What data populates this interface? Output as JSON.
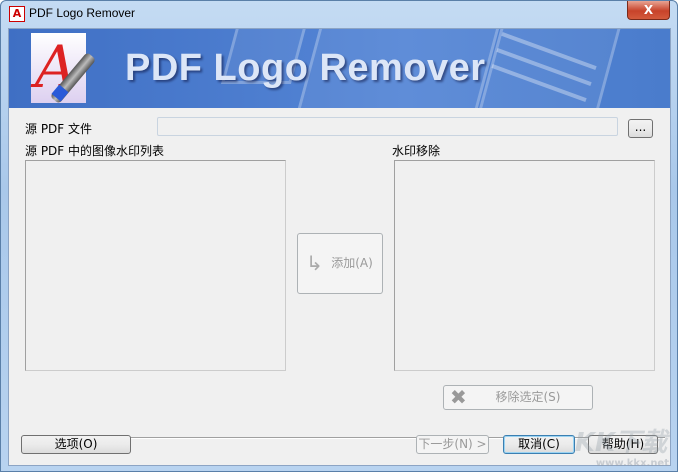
{
  "window": {
    "title": "PDF Logo Remover",
    "close_label": "X"
  },
  "banner": {
    "title": "PDF Logo Remover"
  },
  "source_file": {
    "label": "源 PDF 文件",
    "value": "",
    "browse_label": "..."
  },
  "left_list": {
    "label": "源 PDF 中的图像水印列表",
    "items": []
  },
  "right_list": {
    "label": "水印移除",
    "items": []
  },
  "buttons": {
    "add": "添加(A)",
    "remove_selected": "移除选定(S)",
    "options": "选项(O)",
    "next": "下一步(N) >",
    "cancel": "取消(C)",
    "help": "帮助(H)"
  },
  "watermark": {
    "brand": "KK下载",
    "url": "www.kkx.net"
  }
}
